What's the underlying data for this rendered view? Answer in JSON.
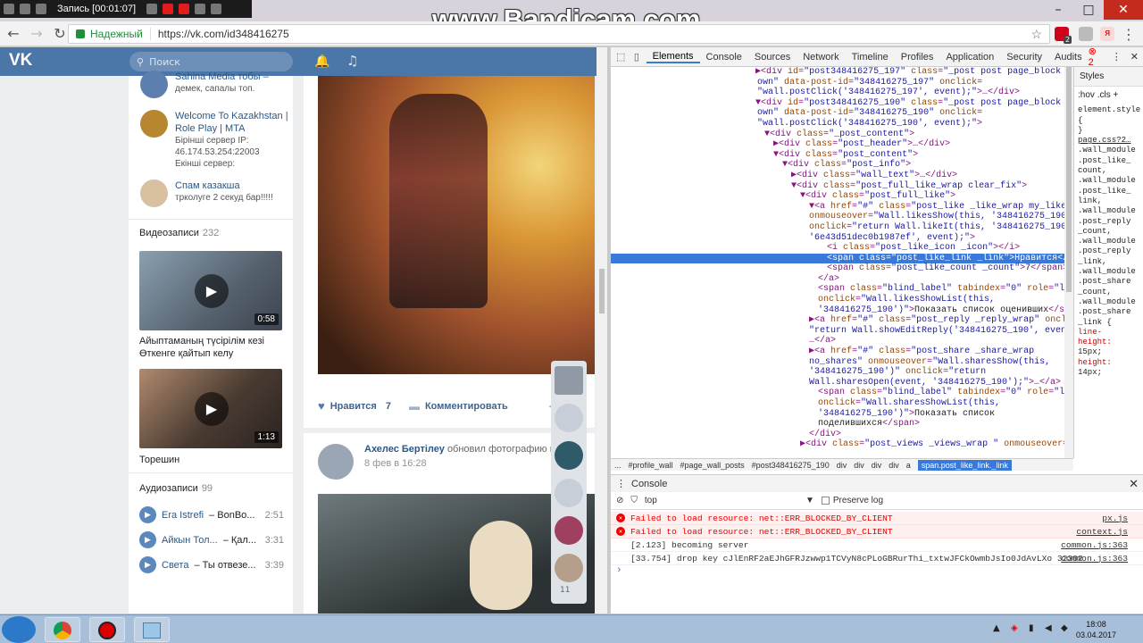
{
  "recorder": {
    "label": "Запись [00:01:07]",
    "watermark": "www.Bandicam.com"
  },
  "browser": {
    "secure_label": "Надежный",
    "url": "https://vk.com/id348416275",
    "ext_badge": "2"
  },
  "vk": {
    "search_placeholder": "Поиск",
    "groups": [
      {
        "title": "Sahina Media тобы –",
        "sub": "демек, сапалы топ."
      },
      {
        "title": "Welcome To Kazakhstan |",
        "title2": "Role Play | MTA",
        "sub": "Бірінші сервер IP:",
        "sub2": "46.174.53.254:22003",
        "sub3": "Екінші сервер:"
      },
      {
        "title": "Спам казакша",
        "sub": "трколуге 2 секуд бар!!!!!"
      }
    ],
    "videos_title": "Видеозаписи",
    "videos_count": "232",
    "videos": [
      {
        "duration": "0:58",
        "caption": "Айыптаманың түсірілім кезі",
        "caption2": "Өткенге қайтып келу"
      },
      {
        "duration": "1:13",
        "caption": "Торешин"
      }
    ],
    "audio_title": "Аудиозаписи",
    "audio_count": "99",
    "audios": [
      {
        "artist": "Era Istrefi",
        "title": "– BonBo...",
        "duration": "2:51"
      },
      {
        "artist": "Айкын Тол...",
        "title": "– Қал...",
        "duration": "3:31"
      },
      {
        "artist": "Света",
        "title": "– Ты отвезе...",
        "duration": "3:39"
      }
    ],
    "post1": {
      "like_label": "Нравится",
      "like_count": "7",
      "comment_label": "Комментировать"
    },
    "post2": {
      "author": "Ахелес Бертілеу",
      "action": "обновил фотографию на с...",
      "date": "8 фев в 16:28"
    },
    "friends_count": "11"
  },
  "devtools": {
    "tabs": [
      "Elements",
      "Console",
      "Sources",
      "Network",
      "Timeline",
      "Profiles",
      "Application",
      "Security",
      "Audits"
    ],
    "error_count": "2",
    "styles_tab": "Styles",
    "styles_hov": ":hov",
    "styles_cls": ".cls",
    "styles_plus": "+",
    "styles_lines": [
      "element.style",
      "{",
      "}",
      "page.css?2…",
      ".wall_module",
      ".post_like_",
      "count,",
      ".wall_module",
      ".post_like_",
      "link,",
      ".wall_module",
      ".post_reply",
      "_count,",
      ".wall_module",
      ".post_reply",
      "_link,",
      ".wall_module",
      ".post_share",
      "_count,",
      ".wall_module",
      ".post_share",
      "_link {",
      "line-",
      "height:",
      "15px;",
      "height:",
      "14px;"
    ],
    "breadcrumbs": [
      "...",
      "#profile_wall",
      "#page_wall_posts",
      "#post348416275_190",
      "div",
      "div",
      "div",
      "div",
      "a",
      "span.post_like_link._link"
    ],
    "console_title": "Console",
    "console_context": "top",
    "preserve_log": "Preserve log",
    "console_logs": [
      {
        "type": "error",
        "text": "Failed to load resource: net::ERR_BLOCKED_BY_CLIENT",
        "src": "px.js"
      },
      {
        "type": "error",
        "text": "Failed to load resource: net::ERR_BLOCKED_BY_CLIENT",
        "src": "context.js"
      },
      {
        "type": "log",
        "text": "[2.123]  becoming server",
        "src": "common.js:363"
      },
      {
        "type": "log",
        "text": "[33.754]  drop key cJlEnRF2aEJhGFRJzwwp1TCVyN8cPLoGBRurThi_txtwJFCkOwmbJsIo0JdAvLXo 32302",
        "src": "common.js:363"
      }
    ]
  },
  "taskbar": {
    "time": "18:08",
    "date": "03.04.2017"
  }
}
